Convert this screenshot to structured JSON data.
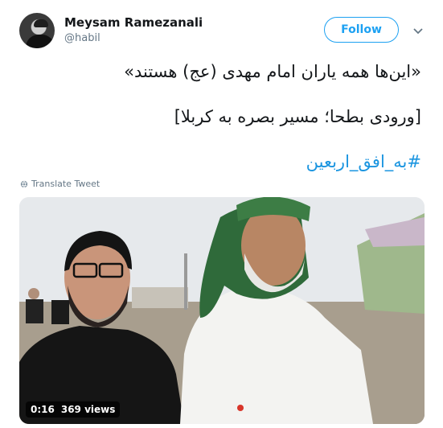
{
  "tweet": {
    "author_name": "Meysam Ramezanali",
    "author_handle": "@habil",
    "follow_label": "Follow",
    "text_line1": "«این‌ها همه یاران امام مهدی (عج) هستند»",
    "text_line2": "[ورودی بطحا؛ مسیر بصره به کربلا]",
    "hashtag": "#به_افق_اربعین",
    "translate_label": "Translate Tweet"
  },
  "video": {
    "duration": "0:16",
    "views": "369 views"
  },
  "colors": {
    "accent": "#1da1f2",
    "link": "#1b95e0",
    "muted": "#657786",
    "text": "#14171a"
  },
  "icons": [
    "avatar",
    "chevron-down-icon",
    "globe-icon"
  ]
}
